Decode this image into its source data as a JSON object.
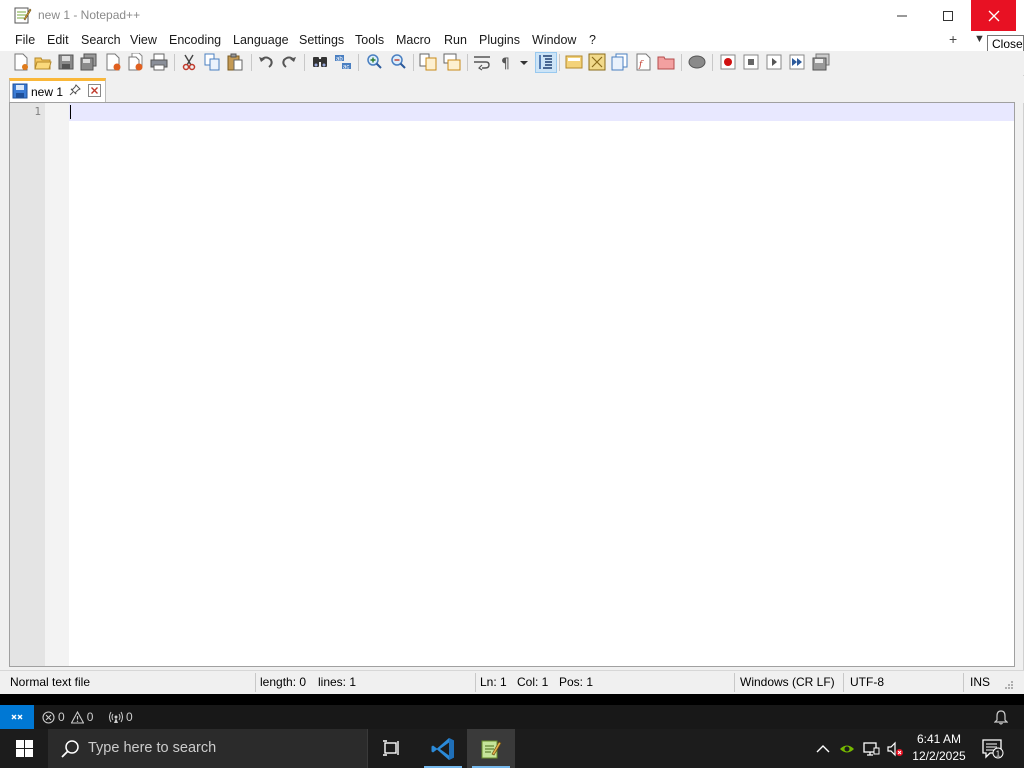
{
  "window": {
    "title": "new 1 - Notepad++",
    "tooltip": "Close"
  },
  "menu": {
    "items": [
      "File",
      "Edit",
      "Search",
      "View",
      "Encoding",
      "Language",
      "Settings",
      "Tools",
      "Macro",
      "Run",
      "Plugins",
      "Window",
      "?"
    ],
    "plus": "+",
    "dropdown": "▼"
  },
  "toolbar": {
    "icons": [
      "new-file-icon",
      "open-file-icon",
      "save-icon",
      "save-all-icon",
      "close-icon",
      "close-all-icon",
      "print-icon",
      "cut-icon",
      "copy-icon",
      "paste-icon",
      "undo-icon",
      "redo-icon",
      "find-icon",
      "replace-icon",
      "zoom-in-icon",
      "zoom-out-icon",
      "sync-vertical-icon",
      "sync-horizontal-icon",
      "word-wrap-icon",
      "show-all-chars-icon",
      "indent-guide-icon",
      "user-lang-icon",
      "document-map-icon",
      "document-list-icon",
      "function-list-icon",
      "folder-workspace-icon",
      "monitoring-icon",
      "record-macro-icon",
      "stop-record-icon",
      "play-macro-icon",
      "run-macro-multiple-icon",
      "save-macro-icon"
    ]
  },
  "tab": {
    "label": "new 1"
  },
  "editor": {
    "line_number": "1"
  },
  "status": {
    "file_type": "Normal text file",
    "length": "length: 0",
    "lines": "lines: 1",
    "ln": "Ln: 1",
    "col": "Col: 1",
    "pos": "Pos: 1",
    "eol": "Windows (CR LF)",
    "encoding": "UTF-8",
    "mode": "INS"
  },
  "vscode_bar": {
    "errors": "0",
    "warnings": "0",
    "ports": "0"
  },
  "taskbar": {
    "search_placeholder": "Type here to search",
    "time": "6:41 AM",
    "date": "12/2/2025",
    "notification_count": "1"
  },
  "colors": {
    "close_button": "#e81123",
    "tab_accent": "#fab739",
    "current_line": "#e8e8ff",
    "vscode_remote": "#0078d4",
    "taskbar": "#1c1c1c"
  }
}
